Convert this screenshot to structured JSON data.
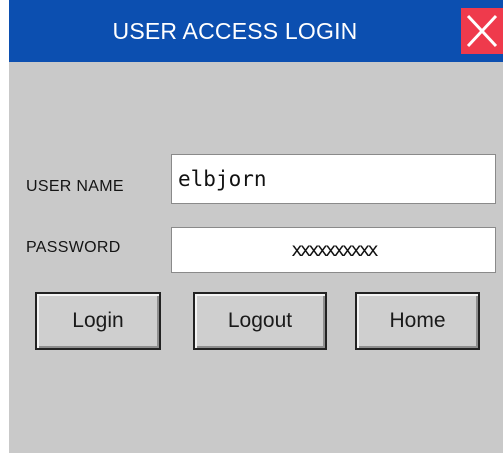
{
  "window": {
    "title": "USER ACCESS LOGIN",
    "close_icon": "close-icon"
  },
  "form": {
    "user_name_label": "USER NAME",
    "user_name_value": "elbjorn",
    "password_label": "PASSWORD",
    "password_value": "xxxxxxxxxx"
  },
  "buttons": {
    "login": "Login",
    "logout": "Logout",
    "home": "Home"
  },
  "colors": {
    "titlebar": "#0c4fb0",
    "close_button": "#ef3a4c",
    "background": "#c9c9c9"
  }
}
